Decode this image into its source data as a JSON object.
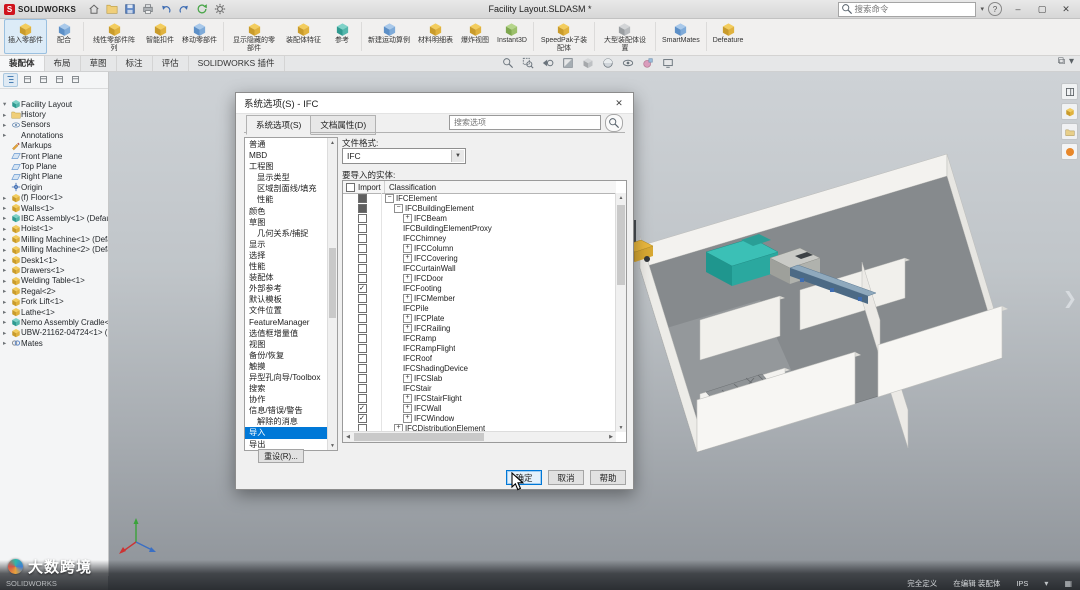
{
  "window": {
    "brand": "SOLIDWORKS",
    "title": "Facility Layout.SLDASM *",
    "search_placeholder": "搜索命令",
    "quick_icons": [
      "home-icon",
      "open-icon",
      "save-icon",
      "print-icon",
      "undo-icon",
      "redo-icon",
      "rebuild-icon",
      "settings-icon"
    ]
  },
  "ribbon": {
    "tools": [
      {
        "label": "插入零部件",
        "active": true
      },
      {
        "label": "配合"
      },
      {
        "label": "线性零部件阵列"
      },
      {
        "label": "智能扣件"
      },
      {
        "label": "移动零部件"
      },
      {
        "label": "显示隐藏的零部件"
      },
      {
        "label": "装配体特征"
      },
      {
        "label": "参考"
      },
      {
        "label": "新建运动算例"
      },
      {
        "label": "材料明细表"
      },
      {
        "label": "爆炸视图"
      },
      {
        "label": "Instant3D"
      },
      {
        "label": "SpeedPak子装配体"
      },
      {
        "label": "大型装配体设置"
      },
      {
        "label": "SmartMates"
      },
      {
        "label": "Defeature"
      }
    ],
    "tabs": [
      {
        "label": "装配体",
        "active": true
      },
      {
        "label": "布局"
      },
      {
        "label": "草图"
      },
      {
        "label": "标注"
      },
      {
        "label": "评估"
      },
      {
        "label": "SOLIDWORKS 插件"
      }
    ]
  },
  "feature_panel": {
    "tree": [
      {
        "label": "Facility Layout",
        "icon": "assembly-icon",
        "arrow": "down"
      },
      {
        "label": "History",
        "icon": "folder-icon",
        "arrow": "right"
      },
      {
        "label": "Sensors",
        "icon": "sensors-icon",
        "arrow": "right"
      },
      {
        "label": "Annotations",
        "icon": "annotations-icon",
        "arrow": "right"
      },
      {
        "label": "Markups",
        "icon": "markups-icon",
        "arrow": "none"
      },
      {
        "label": "Front Plane",
        "icon": "plane-icon",
        "arrow": "none"
      },
      {
        "label": "Top Plane",
        "icon": "plane-icon",
        "arrow": "none"
      },
      {
        "label": "Right Plane",
        "icon": "plane-icon",
        "arrow": "none"
      },
      {
        "label": "Origin",
        "icon": "origin-icon",
        "arrow": "none"
      },
      {
        "label": "(f) Floor<1>",
        "icon": "part-icon",
        "arrow": "right"
      },
      {
        "label": "Walls<1>",
        "icon": "part-icon",
        "arrow": "right"
      },
      {
        "label": "IBC Assembly<1> (Default",
        "icon": "assembly-icon",
        "arrow": "right"
      },
      {
        "label": "Hoist<1>",
        "icon": "part-icon",
        "arrow": "right"
      },
      {
        "label": "Milling Machine<1> (Defa...",
        "icon": "part-icon",
        "arrow": "right"
      },
      {
        "label": "Milling Machine<2> (Defa...",
        "icon": "part-icon",
        "arrow": "right"
      },
      {
        "label": "Desk1<1>",
        "icon": "part-icon",
        "arrow": "right"
      },
      {
        "label": "Drawers<1>",
        "icon": "part-icon",
        "arrow": "right"
      },
      {
        "label": "Welding Table<1>",
        "icon": "part-icon",
        "arrow": "right"
      },
      {
        "label": "Regal<2>",
        "icon": "part-icon",
        "arrow": "right"
      },
      {
        "label": "Fork Lift<1>",
        "icon": "part-icon",
        "arrow": "right"
      },
      {
        "label": "Lathe<1>",
        "icon": "part-icon",
        "arrow": "right"
      },
      {
        "label": "Nemo Assembly Cradle<1...",
        "icon": "assembly-icon",
        "arrow": "right"
      },
      {
        "label": "UBW-21162-04724<1> (De...",
        "icon": "part-icon",
        "arrow": "right"
      },
      {
        "label": "Mates",
        "icon": "mates-icon",
        "arrow": "right"
      }
    ]
  },
  "viewport": {
    "headsup_icons": [
      "zoom-fit-icon",
      "zoom-to-area-icon",
      "previous-view-icon",
      "section-view-icon",
      "view-orientation-icon",
      "display-style-icon",
      "hide-show-items-icon",
      "edit-appearance-icon",
      "view-settings-icon"
    ],
    "right_panel_icons": [
      "taskpane-icon",
      "design-library-icon",
      "file-explorer-icon",
      "recording-icon"
    ]
  },
  "dialog": {
    "title": "系统选项(S) - IFC",
    "tabs": [
      "系统选项(S)",
      "文档属性(D)"
    ],
    "search_placeholder": "搜索选项",
    "categories": [
      {
        "label": "普通",
        "indent": 0
      },
      {
        "label": "MBD",
        "indent": 0
      },
      {
        "label": "工程图",
        "indent": 0
      },
      {
        "label": "显示类型",
        "indent": 1
      },
      {
        "label": "区域剖面线/填充",
        "indent": 1
      },
      {
        "label": "性能",
        "indent": 1
      },
      {
        "label": "颜色",
        "indent": 0
      },
      {
        "label": "草图",
        "indent": 0
      },
      {
        "label": "几何关系/捕捉",
        "indent": 1
      },
      {
        "label": "显示",
        "indent": 0
      },
      {
        "label": "选择",
        "indent": 0
      },
      {
        "label": "性能",
        "indent": 0
      },
      {
        "label": "装配体",
        "indent": 0
      },
      {
        "label": "外部参考",
        "indent": 0
      },
      {
        "label": "默认模板",
        "indent": 0
      },
      {
        "label": "文件位置",
        "indent": 0
      },
      {
        "label": "FeatureManager",
        "indent": 0
      },
      {
        "label": "选值框增量值",
        "indent": 0
      },
      {
        "label": "视图",
        "indent": 0
      },
      {
        "label": "备份/恢复",
        "indent": 0
      },
      {
        "label": "触摸",
        "indent": 0
      },
      {
        "label": "异型孔向导/Toolbox",
        "indent": 0
      },
      {
        "label": "搜索",
        "indent": 0
      },
      {
        "label": "协作",
        "indent": 0
      },
      {
        "label": "信息/错误/警告",
        "indent": 0
      },
      {
        "label": "解除的消息",
        "indent": 1
      },
      {
        "label": "导入",
        "indent": 0,
        "selected": true
      },
      {
        "label": "导出",
        "indent": 0
      }
    ],
    "file_format_label": "文件格式:",
    "file_format_value": "IFC",
    "entities_label": "要导入的实体:",
    "entities": {
      "columns": [
        "Import",
        "Classification"
      ],
      "rows": [
        {
          "name": "IFCElement",
          "level": 0,
          "expander": "minus",
          "state": "mixed"
        },
        {
          "name": "IFCBuildingElement",
          "level": 1,
          "expander": "minus",
          "state": "mixed"
        },
        {
          "name": "IFCBeam",
          "level": 2,
          "expander": "plus",
          "state": "unchecked"
        },
        {
          "name": "IFCBuildingElementProxy",
          "level": 2,
          "expander": "none",
          "state": "unchecked"
        },
        {
          "name": "IFCChimney",
          "level": 2,
          "expander": "none",
          "state": "unchecked"
        },
        {
          "name": "IFCColumn",
          "level": 2,
          "expander": "plus",
          "state": "unchecked"
        },
        {
          "name": "IFCCovering",
          "level": 2,
          "expander": "plus",
          "state": "unchecked"
        },
        {
          "name": "IFCCurtainWall",
          "level": 2,
          "expander": "none",
          "state": "unchecked"
        },
        {
          "name": "IFCDoor",
          "level": 2,
          "expander": "plus",
          "state": "unchecked"
        },
        {
          "name": "IFCFooting",
          "level": 2,
          "expander": "none",
          "state": "checked"
        },
        {
          "name": "IFCMember",
          "level": 2,
          "expander": "plus",
          "state": "unchecked"
        },
        {
          "name": "IFCPile",
          "level": 2,
          "expander": "none",
          "state": "unchecked"
        },
        {
          "name": "IFCPlate",
          "level": 2,
          "expander": "plus",
          "state": "unchecked"
        },
        {
          "name": "IFCRailing",
          "level": 2,
          "expander": "plus",
          "state": "unchecked"
        },
        {
          "name": "IFCRamp",
          "level": 2,
          "expander": "none",
          "state": "unchecked"
        },
        {
          "name": "IFCRampFlight",
          "level": 2,
          "expander": "none",
          "state": "unchecked"
        },
        {
          "name": "IFCRoof",
          "level": 2,
          "expander": "none",
          "state": "unchecked"
        },
        {
          "name": "IFCShadingDevice",
          "level": 2,
          "expander": "none",
          "state": "unchecked"
        },
        {
          "name": "IFCSlab",
          "level": 2,
          "expander": "plus",
          "state": "unchecked"
        },
        {
          "name": "IFCStair",
          "level": 2,
          "expander": "none",
          "state": "unchecked"
        },
        {
          "name": "IFCStairFlight",
          "level": 2,
          "expander": "plus",
          "state": "unchecked"
        },
        {
          "name": "IFCWall",
          "level": 2,
          "expander": "plus",
          "state": "checked"
        },
        {
          "name": "IFCWindow",
          "level": 2,
          "expander": "plus",
          "state": "checked"
        },
        {
          "name": "IFCDistributionElement",
          "level": 1,
          "expander": "plus",
          "state": "unchecked"
        }
      ]
    },
    "reset_label": "重设(R)...",
    "buttons": {
      "ok": "确定",
      "cancel": "取消",
      "help": "帮助"
    }
  },
  "statusbar": {
    "left": "SOLIDWORKS",
    "items": [
      "完全定义",
      "在编辑 装配体",
      "IPS"
    ]
  },
  "watermark": {
    "text": "大数跨境"
  }
}
